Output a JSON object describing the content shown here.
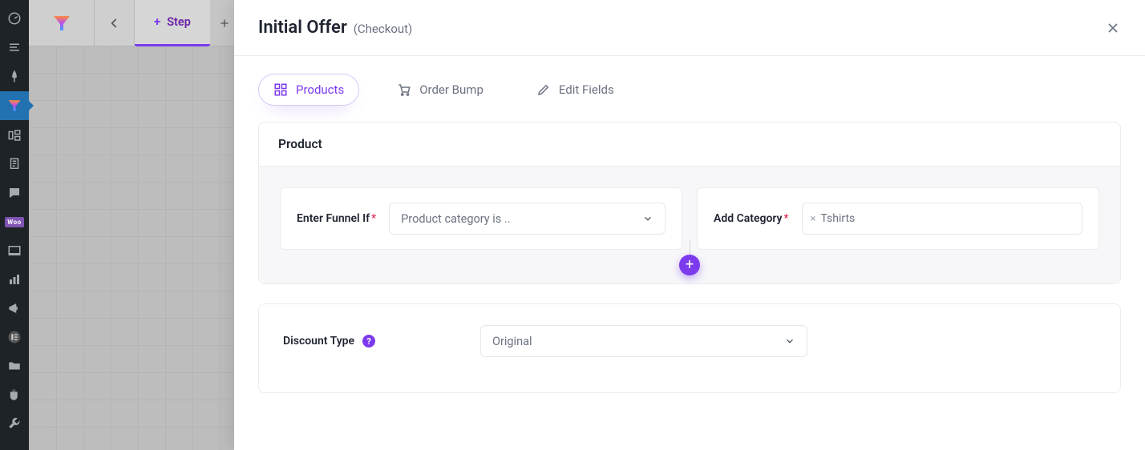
{
  "sidebar_nav": {
    "items": [
      {
        "name": "dashboard-icon"
      },
      {
        "name": "posts-icon"
      },
      {
        "name": "pin-icon"
      },
      {
        "name": "funnel-icon",
        "active": true
      },
      {
        "name": "media-icon"
      },
      {
        "name": "pages-icon"
      },
      {
        "name": "comments-icon"
      },
      {
        "name": "woocommerce-icon",
        "badge": "Woo"
      },
      {
        "name": "appearance-icon"
      },
      {
        "name": "analytics-icon"
      },
      {
        "name": "marketing-icon"
      },
      {
        "name": "elementor-icon"
      },
      {
        "name": "folder-icon"
      },
      {
        "name": "plugins-icon"
      },
      {
        "name": "tools-icon"
      }
    ]
  },
  "tabbar": {
    "step_label": "Step"
  },
  "panel": {
    "title": "Initial Offer",
    "subtitle": "(Checkout)"
  },
  "config_tabs": {
    "products": "Products",
    "order_bump": "Order Bump",
    "edit_fields": "Edit Fields"
  },
  "product_card": {
    "header": "Product",
    "enter_funnel_label": "Enter Funnel If",
    "enter_funnel_value": "Product category is ..",
    "add_category_label": "Add Category",
    "category_tag": "Tshirts"
  },
  "discount": {
    "label": "Discount Type",
    "value": "Original"
  }
}
